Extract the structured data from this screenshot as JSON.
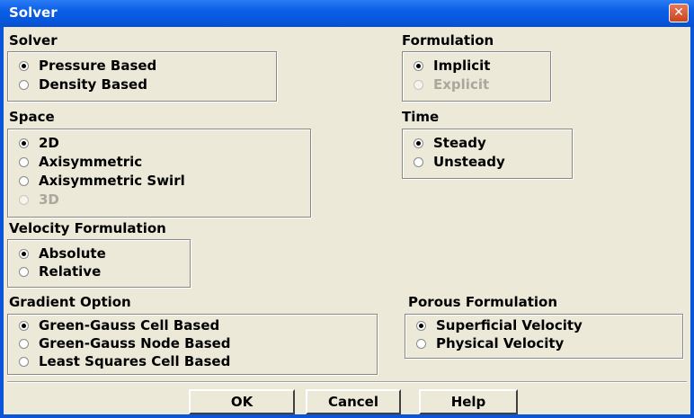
{
  "window": {
    "title": "Solver",
    "close_label": "✕"
  },
  "solver": {
    "label": "Solver",
    "options": [
      {
        "label": "Pressure Based",
        "selected": true,
        "enabled": true
      },
      {
        "label": "Density Based",
        "selected": false,
        "enabled": true
      }
    ]
  },
  "formulation": {
    "label": "Formulation",
    "options": [
      {
        "label": "Implicit",
        "selected": true,
        "enabled": true
      },
      {
        "label": "Explicit",
        "selected": false,
        "enabled": false
      }
    ]
  },
  "space": {
    "label": "Space",
    "options": [
      {
        "label": "2D",
        "selected": true,
        "enabled": true
      },
      {
        "label": "Axisymmetric",
        "selected": false,
        "enabled": true
      },
      {
        "label": "Axisymmetric Swirl",
        "selected": false,
        "enabled": true
      },
      {
        "label": "3D",
        "selected": false,
        "enabled": false
      }
    ]
  },
  "time": {
    "label": "Time",
    "options": [
      {
        "label": "Steady",
        "selected": true,
        "enabled": true
      },
      {
        "label": "Unsteady",
        "selected": false,
        "enabled": true
      }
    ]
  },
  "velocity_formulation": {
    "label": "Velocity Formulation",
    "options": [
      {
        "label": "Absolute",
        "selected": true,
        "enabled": true
      },
      {
        "label": "Relative",
        "selected": false,
        "enabled": true
      }
    ]
  },
  "gradient_option": {
    "label": "Gradient Option",
    "options": [
      {
        "label": "Green-Gauss Cell Based",
        "selected": true,
        "enabled": true
      },
      {
        "label": "Green-Gauss Node Based",
        "selected": false,
        "enabled": true
      },
      {
        "label": "Least Squares Cell Based",
        "selected": false,
        "enabled": true
      }
    ]
  },
  "porous_formulation": {
    "label": "Porous Formulation",
    "options": [
      {
        "label": "Superficial Velocity",
        "selected": true,
        "enabled": true
      },
      {
        "label": "Physical Velocity",
        "selected": false,
        "enabled": true
      }
    ]
  },
  "buttons": {
    "ok": "OK",
    "cancel": "Cancel",
    "help": "Help"
  },
  "colors": {
    "title_bar": "#0a5ee6",
    "window_bg": "#ece9d8",
    "disabled_text": "#aaa89c",
    "close_button": "#d9542c"
  }
}
